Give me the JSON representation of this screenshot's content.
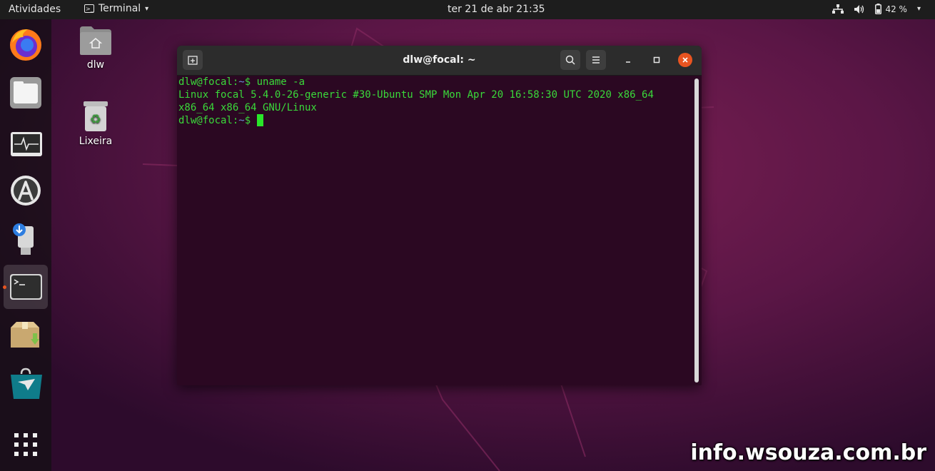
{
  "topbar": {
    "activities": "Atividades",
    "app_name": "Terminal",
    "app_caret": "▾",
    "clock": "ter 21 de abr  21:35",
    "battery": "42 %",
    "menu_caret": "▾"
  },
  "dock": {
    "items": [
      {
        "name": "firefox"
      },
      {
        "name": "files"
      },
      {
        "name": "system-monitor"
      },
      {
        "name": "software-updater"
      },
      {
        "name": "usb-installer"
      },
      {
        "name": "terminal",
        "active": true
      },
      {
        "name": "archive-manager"
      },
      {
        "name": "store"
      },
      {
        "name": "show-applications"
      }
    ]
  },
  "desktop": {
    "home_label": "dlw",
    "trash_label": "Lixeira"
  },
  "terminal": {
    "title": "dlw@focal: ~",
    "lines": {
      "l1_user": "dlw@focal",
      "l1_colon": ":",
      "l1_path": "~",
      "l1_dollar": "$ ",
      "l1_cmd": "uname -a",
      "l2": "Linux focal 5.4.0-26-generic #30-Ubuntu SMP Mon Apr 20 16:58:30 UTC 2020 x86_64",
      "l3": "x86_64 x86_64 GNU/Linux",
      "l4_user": "dlw@focal",
      "l4_colon": ":",
      "l4_path": "~",
      "l4_dollar": "$ "
    }
  },
  "watermark": "info.wsouza.com.br",
  "colors": {
    "accent": "#e95420",
    "terminal_bg": "#300a24",
    "terminal_text": "#3ad93a",
    "path_blue": "#6a8fd8"
  }
}
